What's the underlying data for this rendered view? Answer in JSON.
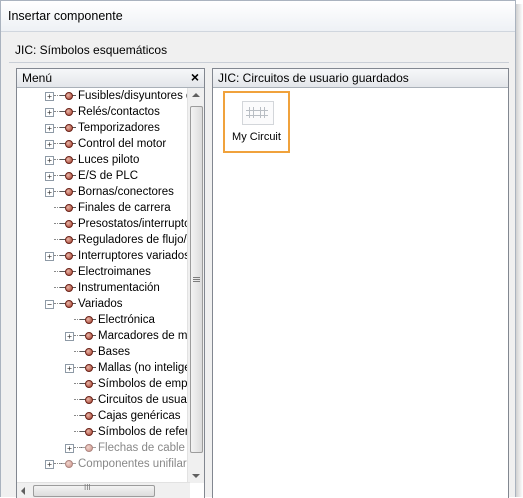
{
  "window": {
    "title": "Insertar componente"
  },
  "library": {
    "title": "JIC: Símbolos esquemáticos"
  },
  "menu": {
    "header": "Menú",
    "close_glyph": "×",
    "items": [
      {
        "label": "Fusibles/disyuntores de",
        "expander": "+",
        "indent": 0,
        "dim": false
      },
      {
        "label": "Relés/contactos",
        "expander": "+",
        "indent": 0,
        "dim": false
      },
      {
        "label": "Temporizadores",
        "expander": "+",
        "indent": 0,
        "dim": false
      },
      {
        "label": "Control del motor",
        "expander": "+",
        "indent": 0,
        "dim": false
      },
      {
        "label": "Luces piloto",
        "expander": "+",
        "indent": 0,
        "dim": false
      },
      {
        "label": "E/S de PLC",
        "expander": "+",
        "indent": 0,
        "dim": false
      },
      {
        "label": "Bornas/conectores",
        "expander": "+",
        "indent": 0,
        "dim": false
      },
      {
        "label": "Finales de carrera",
        "expander": "",
        "indent": 0,
        "dim": false
      },
      {
        "label": "Presostatos/interruptore",
        "expander": "",
        "indent": 0,
        "dim": false
      },
      {
        "label": "Reguladores de flujo/ni",
        "expander": "",
        "indent": 0,
        "dim": false
      },
      {
        "label": "Interruptores variados",
        "expander": "+",
        "indent": 0,
        "dim": false
      },
      {
        "label": "Electroimanes",
        "expander": "",
        "indent": 0,
        "dim": false
      },
      {
        "label": "Instrumentación",
        "expander": "",
        "indent": 0,
        "dim": false
      },
      {
        "label": "Variados",
        "expander": "−",
        "indent": 0,
        "dim": false
      },
      {
        "label": "Electrónica",
        "expander": "",
        "indent": 1,
        "dim": false
      },
      {
        "label": "Marcadores de mar",
        "expander": "+",
        "indent": 1,
        "dim": false
      },
      {
        "label": "Bases",
        "expander": "",
        "indent": 1,
        "dim": false
      },
      {
        "label": "Mallas (no inteligen",
        "expander": "+",
        "indent": 1,
        "dim": false
      },
      {
        "label": "Símbolos de empal",
        "expander": "",
        "indent": 1,
        "dim": false
      },
      {
        "label": "Circuitos de usuario",
        "expander": "",
        "indent": 1,
        "dim": false
      },
      {
        "label": "Cajas genéricas",
        "expander": "",
        "indent": 1,
        "dim": false
      },
      {
        "label": "Símbolos de referer",
        "expander": "",
        "indent": 1,
        "dim": false
      },
      {
        "label": "Flechas de cable se",
        "expander": "+",
        "indent": 1,
        "dim": true
      },
      {
        "label": "Componentes unifilares",
        "expander": "+",
        "indent": 0,
        "dim": true
      }
    ],
    "hscroll_grip": "III"
  },
  "content": {
    "header": "JIC: Circuitos de usuario guardados",
    "tiles": [
      {
        "label": "My Circuit"
      }
    ]
  }
}
